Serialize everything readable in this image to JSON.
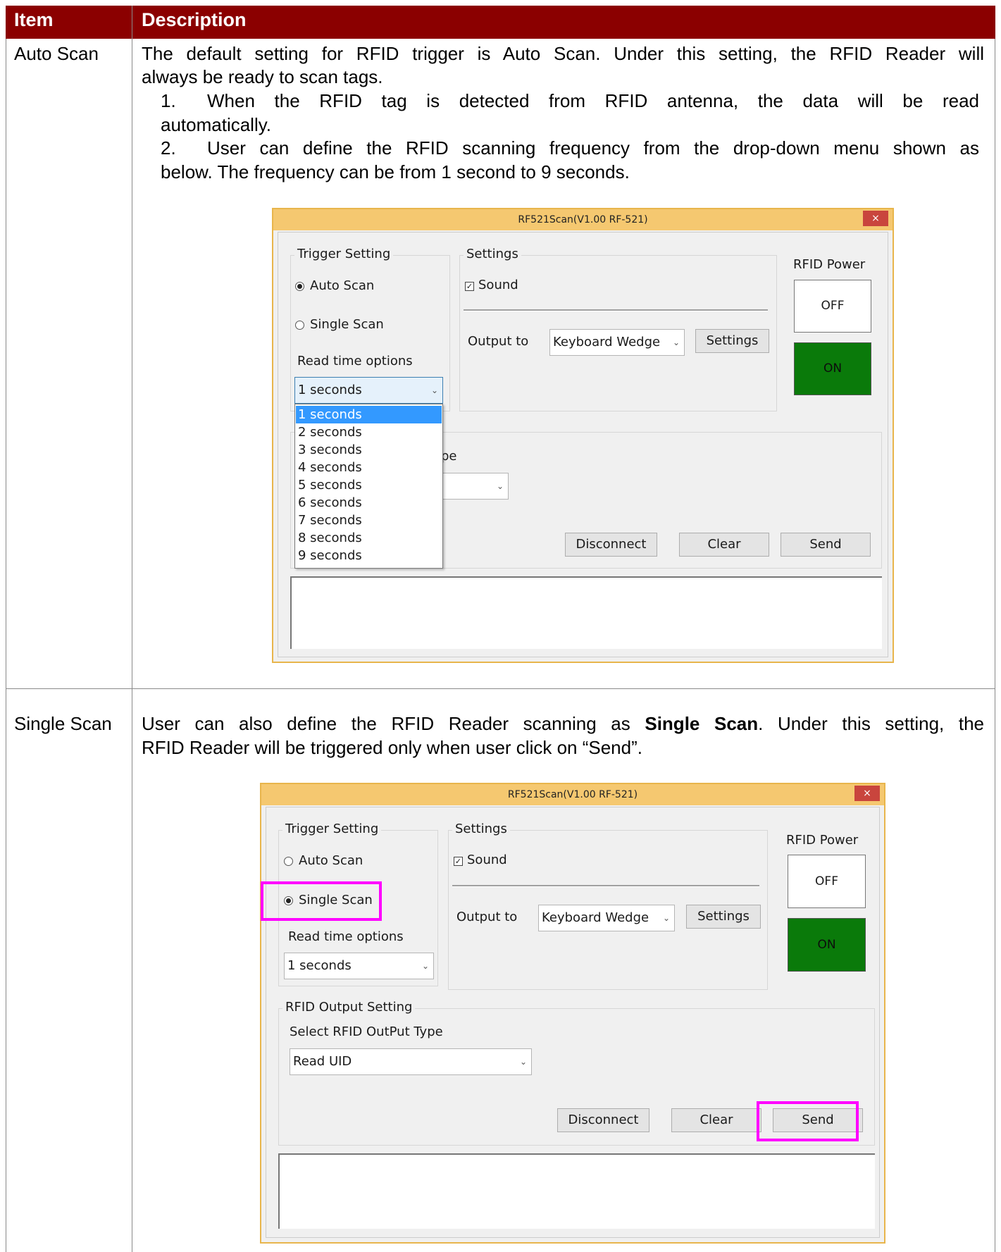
{
  "table": {
    "header": {
      "item": "Item",
      "description": "Description"
    },
    "row1": {
      "item": "Auto Scan",
      "intro_line1": "The default setting for RFID trigger is Auto Scan. Under this setting, the RFID Reader will",
      "intro_line2": "always be ready to scan tags.",
      "point1_num": "1.",
      "point1_line1": "When the RFID tag is detected from RFID antenna, the data will be read",
      "point1_line2": "automatically.",
      "point2_num": "2.",
      "point2_line1": "User can define the RFID scanning frequency from the drop-down menu shown as",
      "point2_line2": "below. The frequency can be from 1 second to 9 seconds."
    },
    "row2": {
      "item": "Single Scan",
      "line1_a": "User can also define the RFID Reader scanning as ",
      "line1_bold": "Single Scan",
      "line1_b": ". Under this setting, the",
      "line2": "RFID Reader will be triggered only when user click on “Send”."
    }
  },
  "dialog1": {
    "title": "RF521Scan(V1.00 RF-521)",
    "close": "×",
    "trigger_setting": "Trigger Setting",
    "auto_scan": "Auto Scan",
    "single_scan": "Single Scan",
    "read_time_options": "Read time options",
    "read_time_value": "1 seconds",
    "dropdown_options": [
      "1 seconds",
      "2 seconds",
      "3 seconds",
      "4 seconds",
      "5 seconds",
      "6 seconds",
      "7 seconds",
      "8 seconds",
      "9 seconds"
    ],
    "selected_index": 0,
    "settings_group": "Settings",
    "sound": "Sound",
    "output_to": "Output to",
    "output_value": "Keyboard Wedge",
    "settings_button": "Settings",
    "rfid_power": "RFID Power",
    "off": "OFF",
    "on": "ON",
    "partial_label": "pe",
    "disconnect": "Disconnect",
    "clear": "Clear",
    "send": "Send"
  },
  "dialog2": {
    "title": "RF521Scan(V1.00 RF-521)",
    "close": "×",
    "trigger_setting": "Trigger Setting",
    "auto_scan": "Auto Scan",
    "single_scan": "Single Scan",
    "read_time_options": "Read time options",
    "read_time_value": "1 seconds",
    "settings_group": "Settings",
    "sound": "Sound",
    "output_to": "Output to",
    "output_value": "Keyboard Wedge",
    "settings_button": "Settings",
    "rfid_power": "RFID Power",
    "off": "OFF",
    "on": "ON",
    "rfid_output_setting": "RFID Output Setting",
    "select_output_type": "Select RFID OutPut Type",
    "output_type_value": "Read UID",
    "disconnect": "Disconnect",
    "clear": "Clear",
    "send": "Send"
  },
  "colors": {
    "header_bg": "#8b0000",
    "window_title": "#f5c870",
    "power_on": "#0a7a0a",
    "highlight": "#ff00ff",
    "selection": "#3399ff"
  }
}
